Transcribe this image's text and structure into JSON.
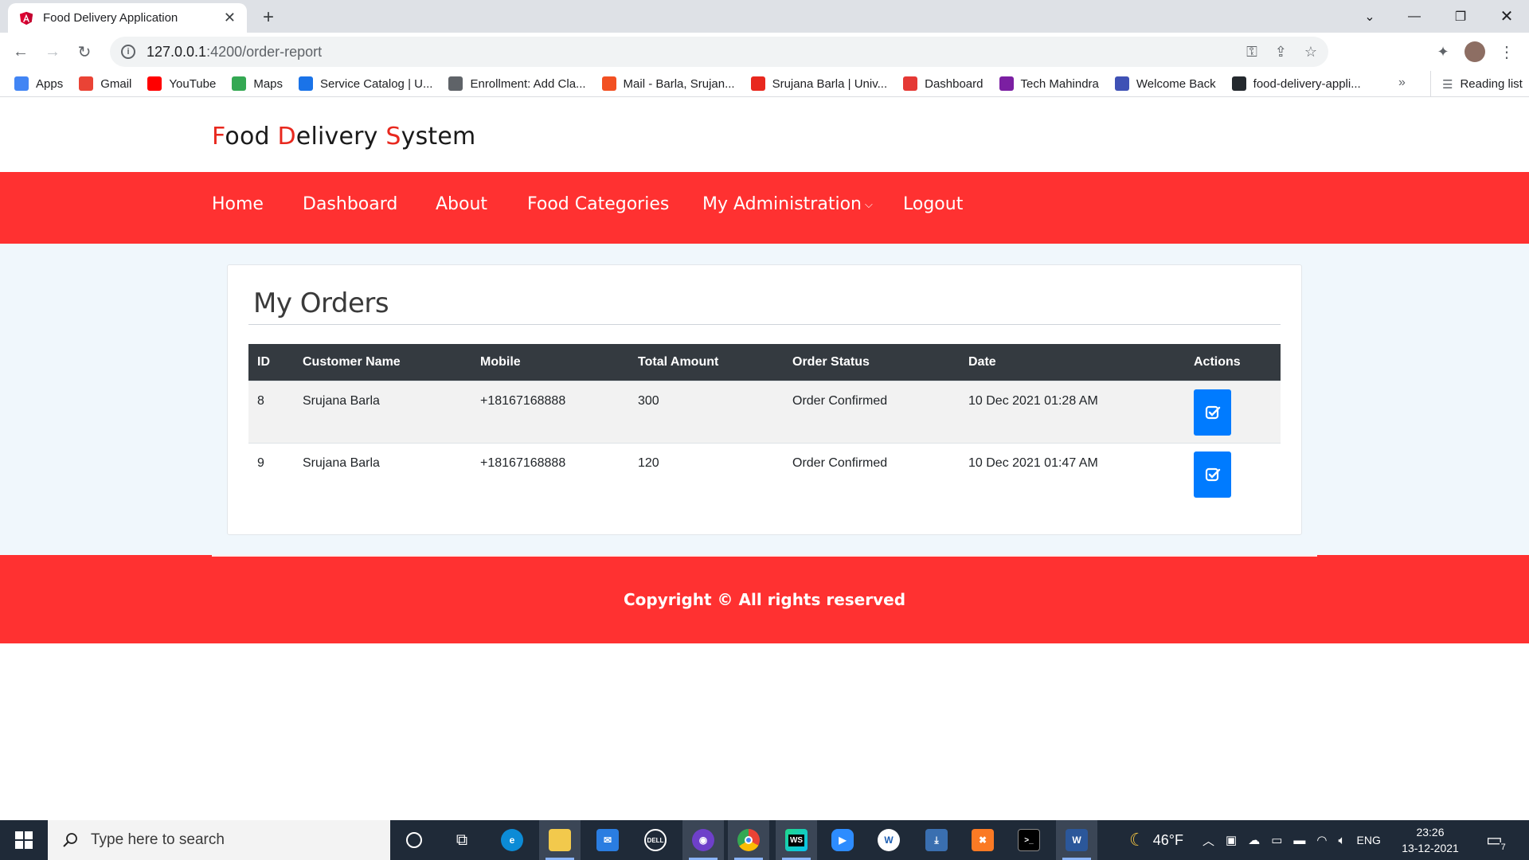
{
  "browser": {
    "tab_title": "Food Delivery Application",
    "url_host": "127.0.0.1",
    "url_path": ":4200/order-report",
    "bookmarks": [
      {
        "label": "Apps",
        "color": "#4285f4"
      },
      {
        "label": "Gmail",
        "color": "#ea4335"
      },
      {
        "label": "YouTube",
        "color": "#ff0000"
      },
      {
        "label": "Maps",
        "color": "#34a853"
      },
      {
        "label": "Service Catalog | U...",
        "color": "#1a73e8"
      },
      {
        "label": "Enrollment: Add Cla...",
        "color": "#5f6368"
      },
      {
        "label": "Mail - Barla, Srujan...",
        "color": "#f25022"
      },
      {
        "label": "Srujana Barla | Univ...",
        "color": "#e8281e"
      },
      {
        "label": "Dashboard",
        "color": "#e53935"
      },
      {
        "label": "Tech Mahindra",
        "color": "#7b1fa2"
      },
      {
        "label": "Welcome Back",
        "color": "#3f51b5"
      },
      {
        "label": "food-delivery-appli...",
        "color": "#24292e"
      }
    ],
    "more": "»",
    "reading_list": "Reading list"
  },
  "brand": {
    "F": "F",
    "ood": "ood ",
    "D": "D",
    "elivery": "elivery ",
    "S": "S",
    "ystem": "ystem"
  },
  "nav": {
    "home": "Home",
    "dashboard": "Dashboard",
    "about": "About",
    "food_categories": "Food Categories",
    "my_administration": "My Administration",
    "logout": "Logout"
  },
  "orders": {
    "title": "My Orders",
    "columns": [
      "ID",
      "Customer Name",
      "Mobile",
      "Total Amount",
      "Order Status",
      "Date",
      "Actions"
    ],
    "rows": [
      {
        "id": "8",
        "customer": "Srujana Barla",
        "mobile": "+18167168888",
        "total": "300",
        "status": "Order Confirmed",
        "date": "10 Dec 2021 01:28 AM"
      },
      {
        "id": "9",
        "customer": "Srujana Barla",
        "mobile": "+18167168888",
        "total": "120",
        "status": "Order Confirmed",
        "date": "10 Dec 2021 01:47 AM"
      }
    ]
  },
  "footer": {
    "copyright": "Copyright © All rights reserved"
  },
  "taskbar": {
    "search_placeholder": "Type here to search",
    "weather": "46°F",
    "lang": "ENG",
    "time": "23:26",
    "date": "13-12-2021",
    "notifications": "7"
  },
  "colors": {
    "brand_red": "#ff3131",
    "action_blue": "#007bff",
    "table_header": "#343a40"
  }
}
